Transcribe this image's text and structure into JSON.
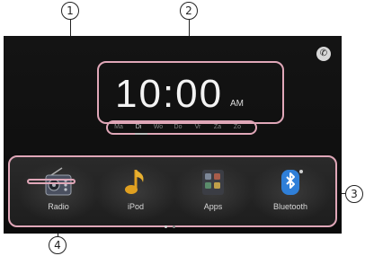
{
  "callouts": {
    "one": "1",
    "two": "2",
    "three": "3",
    "four": "4"
  },
  "clock": {
    "time": "10:00",
    "ampm": "AM"
  },
  "weekdays": [
    {
      "label": "Ma",
      "active": false
    },
    {
      "label": "Di",
      "active": true
    },
    {
      "label": "Wo",
      "active": false
    },
    {
      "label": "Do",
      "active": false
    },
    {
      "label": "Vr",
      "active": false
    },
    {
      "label": "Za",
      "active": false
    },
    {
      "label": "Zo",
      "active": false
    }
  ],
  "dock": {
    "apps": [
      {
        "label": "Radio",
        "icon": "radio-icon"
      },
      {
        "label": "iPod",
        "icon": "music-note-icon"
      },
      {
        "label": "Apps",
        "icon": "apps-icon"
      },
      {
        "label": "Bluetooth",
        "icon": "bluetooth-icon"
      }
    ],
    "page_dots": 2,
    "active_page": 1
  },
  "colors": {
    "highlight": "#e0a7b8",
    "screen": "#121212",
    "text": "#f3f3f3"
  }
}
